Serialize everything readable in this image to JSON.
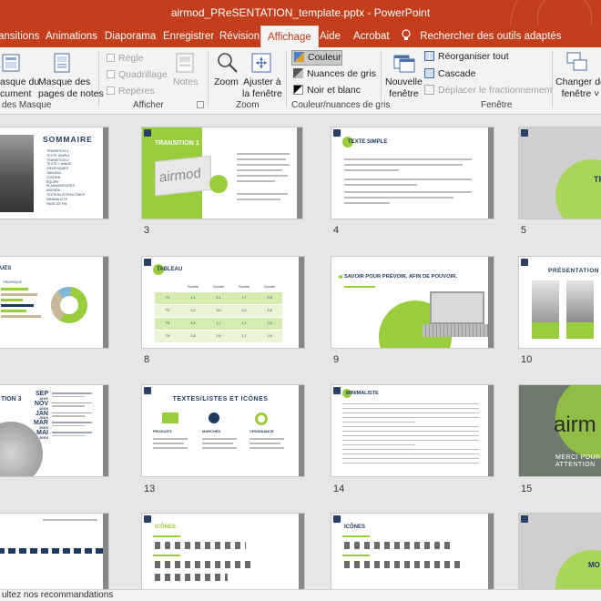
{
  "window": {
    "title": "airmod_PReSENTATION_template.pptx  -  PowerPoint"
  },
  "tabs": [
    {
      "label": "ansitions"
    },
    {
      "label": "Animations"
    },
    {
      "label": "Diaporama"
    },
    {
      "label": "Enregistrer"
    },
    {
      "label": "Révision"
    },
    {
      "label": "Affichage"
    },
    {
      "label": "Aide"
    },
    {
      "label": "Acrobat"
    }
  ],
  "search": {
    "label": "Rechercher des outils adaptés"
  },
  "ribbon": {
    "masque_doc": [
      "asque du",
      "cument"
    ],
    "masque_notes": [
      "Masque des",
      "pages de notes"
    ],
    "group_masque": "des Masque",
    "regle": "Règle",
    "quadrillage": "Quadrillage",
    "reperes": "Repères",
    "notes": "Notes",
    "group_afficher": "Afficher",
    "zoom": "Zoom",
    "ajuster": [
      "Ajuster à",
      "la fenêtre"
    ],
    "group_zoom": "Zoom",
    "couleur": "Couleur",
    "nuances": "Nuances de gris",
    "noir_blanc": "Noir et blanc",
    "group_couleur": "Couleur/nuances de gris",
    "nouvelle": [
      "Nouvelle",
      "fenêtre"
    ],
    "reorganiser": "Réorganiser tout",
    "cascade": "Cascade",
    "deplacer": "Déplacer le fractionnement",
    "group_fenetre": "Fenêtre",
    "changer": [
      "Changer de",
      "fenêtre ˅"
    ]
  },
  "slides": {
    "s2_title": "SOMMAIRE",
    "s2_items": [
      "TRANSITION 1",
      "TEXTE SIMPLE",
      "TRANSITION 2",
      "TEXTE + IMAGE",
      "GRAPHIQUES",
      "TABLEAU",
      "CONTEN",
      "ÉQUIPE",
      "PLANNING/DATES",
      "AGENDA",
      "TEXTES/LISTES/ICÔNES",
      "MINIMALISTE",
      "PAGE DE FIN"
    ],
    "s3_title": "TRANSITION 1",
    "s3_logo": "airmod",
    "s4_title": "TEXTE SIMPLE",
    "s5_title": "TR",
    "s7_title": "UES",
    "s7_sub": "GRAPHIQUE",
    "s8_title": "TABLEAU",
    "s8_header": [
      "Société",
      "Société",
      "Société",
      "Société"
    ],
    "s8_rows": [
      [
        "T1",
        "2,1",
        "2,1",
        "1,7",
        "2,8"
      ],
      [
        "T2",
        "2,2",
        "3,0",
        "3,3",
        "1,8"
      ],
      [
        "T3",
        "2,1",
        "1,7",
        "1,7",
        "2,5"
      ],
      [
        "T4",
        "2,8",
        "2,4",
        "1,7",
        "1,8"
      ]
    ],
    "s9_title": "SAVOIR POUR PRÉVOIR, AFIN DE POUVOIR.",
    "s10_title": "PRÉSENTATION",
    "s11_title": "TION 3",
    "s11_months": [
      "SEP",
      "NOV",
      "JAN",
      "MAR",
      "MAI"
    ],
    "s11_year": "20XX",
    "s12_title": "TEXTES/LISTES ET ICÔNES",
    "s12_cols": [
      "PRODUITS",
      "MARCHÉS",
      "CROISSANCE"
    ],
    "s13_title": "MINIMALISTE",
    "s14_logo": "airm",
    "s14_text": [
      "MERCI POUR",
      "ATTENTION"
    ],
    "s17_title": "ICÔNES",
    "s18_title": "ICÔNES",
    "s19_title": "MO"
  },
  "slide_numbers": [
    "3",
    "4",
    "5",
    "8",
    "9",
    "10",
    "13",
    "14",
    "15"
  ],
  "status": {
    "text": "ultez nos recommandations"
  },
  "colors": {
    "brand": "#c43e1c",
    "green": "#9acd3b",
    "navy": "#1f3a5f"
  }
}
